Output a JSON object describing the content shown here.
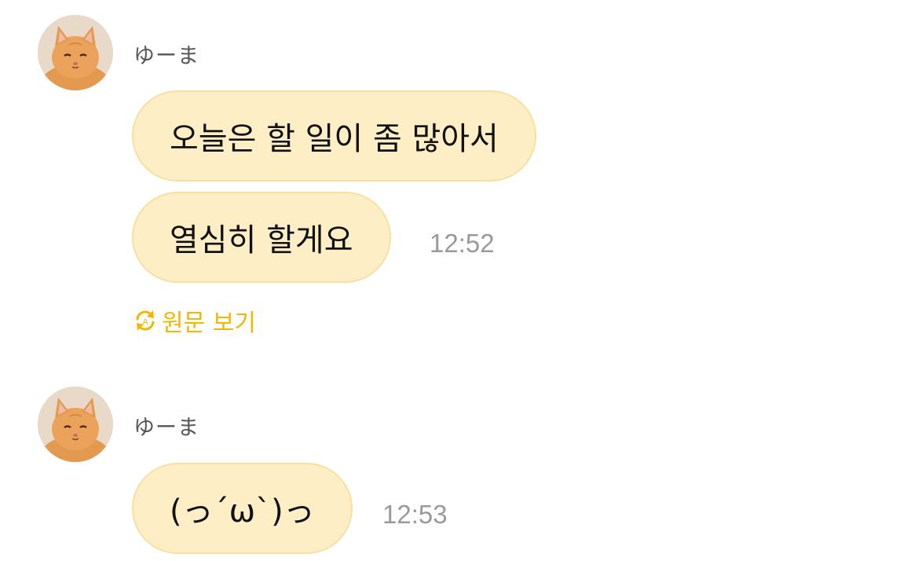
{
  "messages": [
    {
      "sender": "ゆーま",
      "bubbles": [
        {
          "text": "오늘은 할 일이 좀 많아서"
        },
        {
          "text": "열심히 할게요"
        }
      ],
      "time": "12:52",
      "translate_link": {
        "icon": "translate-refresh-icon",
        "label": "원문 보기"
      }
    },
    {
      "sender": "ゆーま",
      "bubbles": [
        {
          "text": "(っ´ω`)っ"
        }
      ],
      "time": "12:53"
    }
  ],
  "colors": {
    "bubble_bg": "#fdeec6",
    "bubble_border": "#f7e0a0",
    "accent": "#f0b800",
    "timestamp": "#9a9a9a",
    "sender": "#555555"
  }
}
